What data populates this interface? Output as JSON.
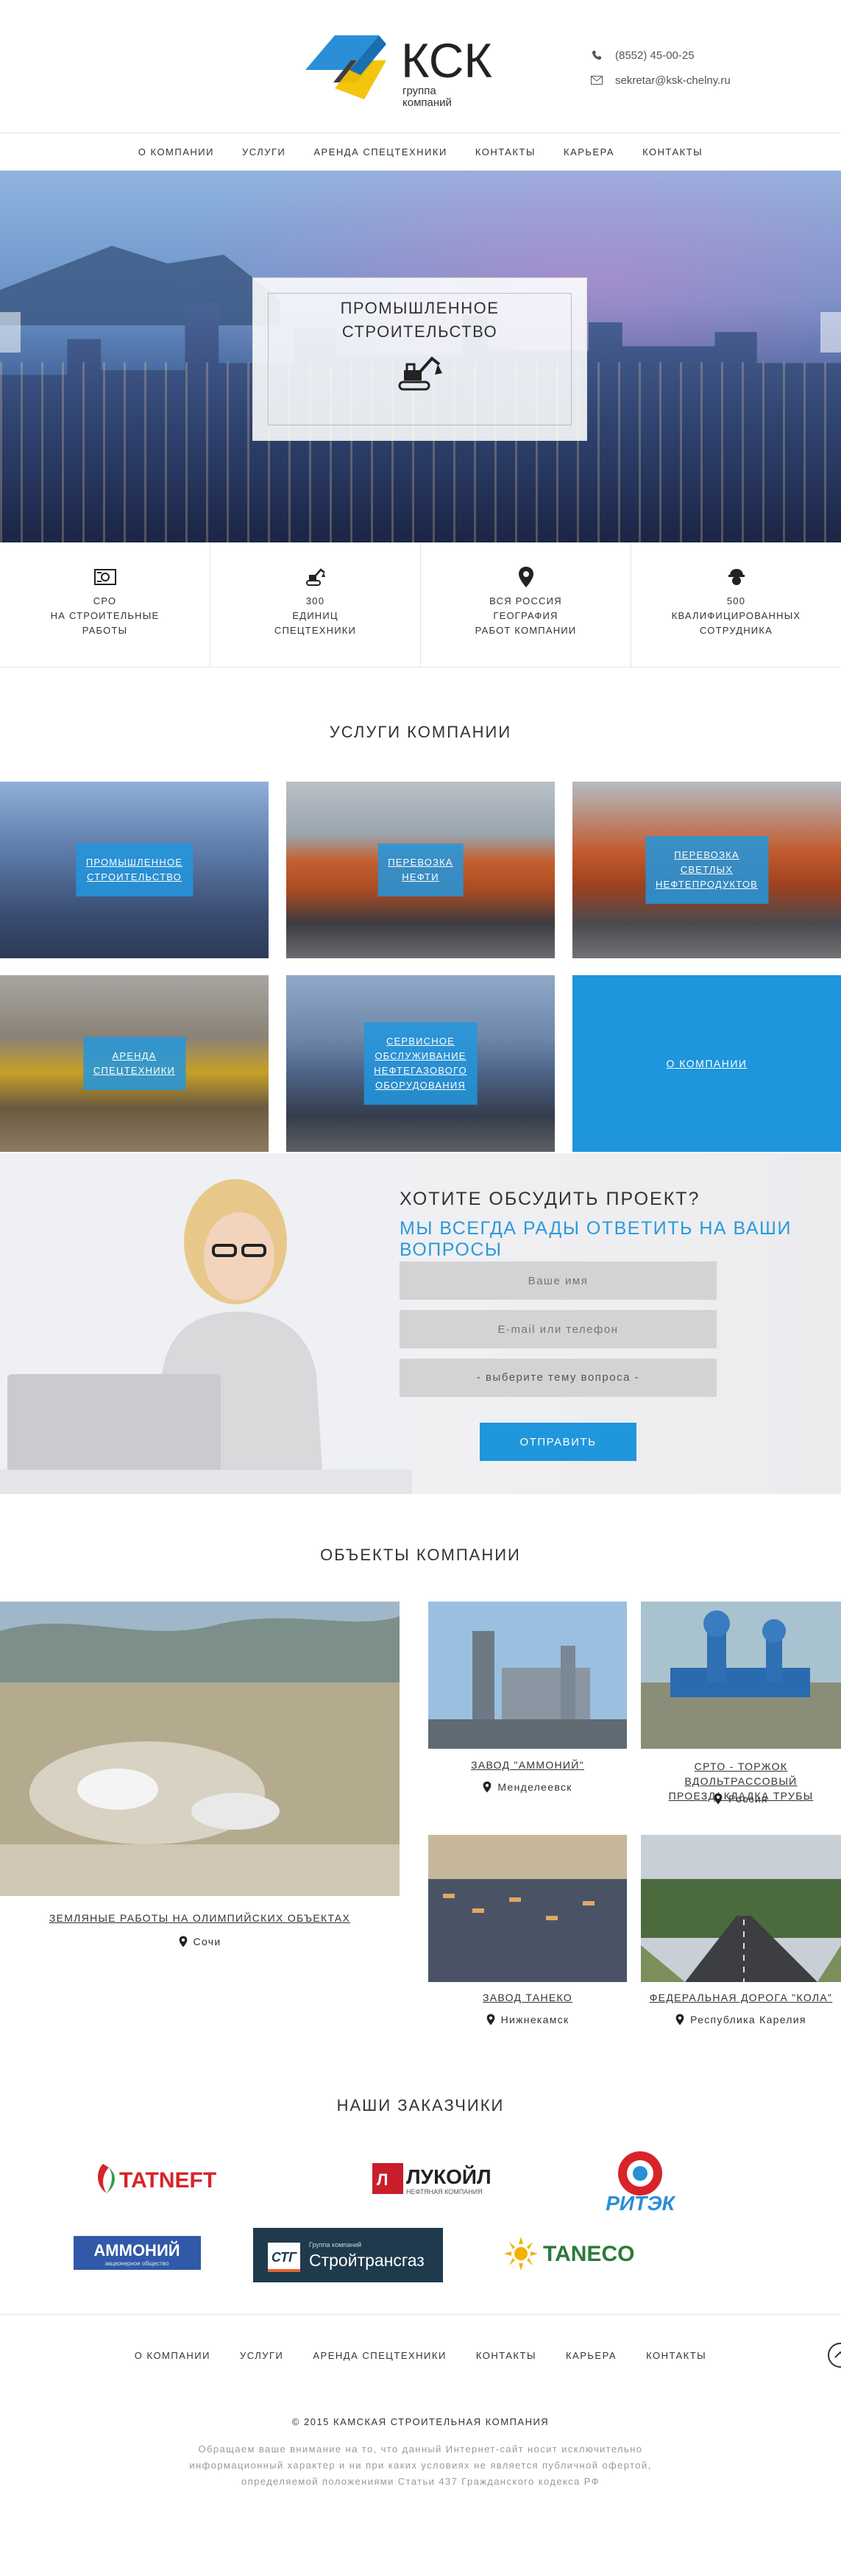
{
  "header": {
    "logo_text": "КСК",
    "logo_sub_line1": "группа",
    "logo_sub_line2": "компаний",
    "phone": "(8552) 45-00-25",
    "email": "sekretar@ksk-chelny.ru",
    "phone_icon": "phone-icon",
    "email_icon": "envelope-icon"
  },
  "nav": [
    "О КОМПАНИИ",
    "УСЛУГИ",
    "АРЕНДА СПЕЦТЕХНИКИ",
    "КОНТАКТЫ",
    "КАРЬЕРА",
    "КОНТАКТЫ"
  ],
  "hero": {
    "title_line1": "ПРОМЫШЛЕННОЕ",
    "title_line2": "СТРОИТЕЛЬСТВО",
    "icon": "excavator-icon"
  },
  "stats": [
    {
      "icon": "certificate-icon",
      "lines": [
        "СРО",
        "НА СТРОИТЕЛЬНЫЕ",
        "РАБОТЫ"
      ]
    },
    {
      "icon": "excavator-icon",
      "lines": [
        "300",
        "ЕДИНИЦ",
        "СПЕЦТЕХНИКИ"
      ]
    },
    {
      "icon": "map-pin-icon",
      "lines": [
        "ВСЯ РОССИЯ",
        "ГЕОГРАФИЯ",
        "РАБОТ КОМПАНИИ"
      ]
    },
    {
      "icon": "worker-icon",
      "lines": [
        "500",
        "КВАЛИФИЦИРОВАННЫХ",
        "СОТРУДНИКА"
      ]
    }
  ],
  "services": {
    "title": "УСЛУГИ КОМПАНИИ",
    "items": [
      {
        "lines": [
          "ПРОМЫШЛЕННОЕ",
          "СТРОИТЕЛЬСТВО"
        ]
      },
      {
        "lines": [
          "ПЕРЕВОЗКА",
          "НЕФТИ"
        ]
      },
      {
        "lines": [
          "ПЕРЕВОЗКА",
          "СВЕТЛЫХ",
          "НЕФТЕПРОДУКТОВ"
        ]
      },
      {
        "lines": [
          "АРЕНДА",
          "СПЕЦТЕХНИКИ"
        ]
      },
      {
        "lines": [
          "СЕРВИСНОЕ",
          "ОБСЛУЖИВАНИЕ",
          "НЕФТЕГАЗОВОГО",
          "ОБОРУДОВАНИЯ"
        ]
      }
    ],
    "about_label": "О КОМПАНИИ"
  },
  "cta": {
    "title": "ХОТИТЕ ОБСУДИТЬ ПРОЕКТ?",
    "subtitle": "МЫ ВСЕГДА РАДЫ ОТВЕТИТЬ НА ВАШИ ВОПРОСЫ",
    "name_placeholder": "Ваше имя",
    "contact_placeholder": "E-mail или телефон",
    "topic_placeholder": "- выберите тему вопроса -",
    "submit": "ОТПРАВИТЬ"
  },
  "objects": {
    "title": "ОБЪЕКТЫ КОМПАНИИ",
    "items": [
      {
        "caption": "ЗЕМЛЯНЫЕ РАБОТЫ НА ОЛИМПИЙСКИХ ОБЪЕКТАХ",
        "location": "Сочи"
      },
      {
        "caption": "ЗАВОД \"АММОНИЙ\"",
        "location": "Менделеевск"
      },
      {
        "caption_line1": "СРТО - ТОРЖОК ВДОЛЬТРАССОВЫЙ",
        "caption_line2": "ПРОЕЗД/ КЛАДКА ТРУБЫ",
        "location": "Россия"
      },
      {
        "caption": "ЗАВОД ТАНЕКО",
        "location": "Нижнекамск"
      },
      {
        "caption": "ФЕДЕРАЛЬНАЯ ДОРОГА \"КОЛА\"",
        "location": "Республика Карелия"
      }
    ]
  },
  "clients": {
    "title": "НАШИ ЗАКАЗЧИКИ",
    "logos": [
      {
        "name": "TATNEFT"
      },
      {
        "name": "ЛУКОЙЛ",
        "sub": "НЕФТЯНАЯ КОМПАНИЯ"
      },
      {
        "name": "РИТЭК"
      },
      {
        "name": "АММОНИЙ",
        "sub": "акционерное общество"
      },
      {
        "name": "Стройтрансгаз",
        "badge": "СТГ",
        "sub": "Группа компаний"
      },
      {
        "name": "TANECO"
      }
    ]
  },
  "footer": {
    "nav": [
      "О КОМПАНИИ",
      "УСЛУГИ",
      "АРЕНДА СПЕЦТЕХНИКИ",
      "КОНТАКТЫ",
      "КАРЬЕРА",
      "КОНТАКТЫ"
    ],
    "copyright": "© 2015 КАМСКАЯ СТРОИТЕЛЬНАЯ КОМПАНИЯ",
    "disclaimer": "Обращаем ваше внимание на то, что данный Интернет-сайт носит исключительно информационный характер и ни при каких условиях не является публичной офертой, определяемой положениями Статьи 437 Гражданского кодекса РФ"
  },
  "colors": {
    "accent_blue": "#1e95dc",
    "logo_blue": "#2a8fd6",
    "logo_yellow": "#f2c200"
  }
}
